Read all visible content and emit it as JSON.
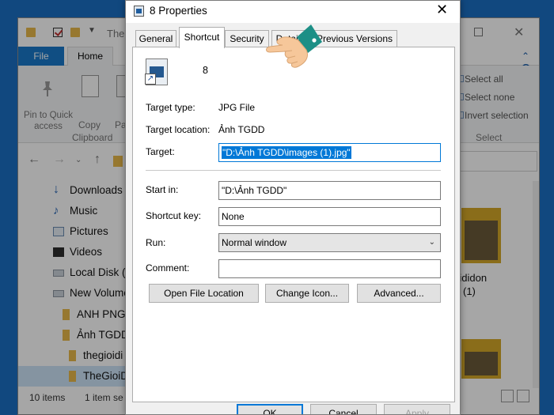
{
  "explorer": {
    "title": "The",
    "tabs": {
      "file": "File",
      "home": "Home"
    },
    "ribbon": {
      "pin_label": "Pin to Quick access",
      "copy_label": "Copy",
      "paste_label": "Pa",
      "clipboard_group": "Clipboard",
      "select_all": "Select all",
      "select_none": "Select none",
      "invert_selection": "Invert selection",
      "select_group": "Select"
    },
    "sidebar": [
      {
        "label": "Downloads",
        "icon": "download-icon"
      },
      {
        "label": "Music",
        "icon": "music-icon"
      },
      {
        "label": "Pictures",
        "icon": "pictures-icon"
      },
      {
        "label": "Videos",
        "icon": "videos-icon"
      },
      {
        "label": "Local Disk (C",
        "icon": "disk-icon"
      },
      {
        "label": "New Volume",
        "icon": "disk-icon"
      },
      {
        "label": "ANH PNG",
        "icon": "folder-icon"
      },
      {
        "label": "Ảnh TGDD",
        "icon": "folder-icon"
      },
      {
        "label": "thegioidi",
        "icon": "folder-icon"
      },
      {
        "label": "TheGioiD",
        "icon": "folder-icon"
      }
    ],
    "files": [
      {
        "name_line1": "gioididon",
        "name_line2": "(1)"
      }
    ],
    "status": {
      "items": "10 items",
      "selected": "1 item se"
    }
  },
  "dialog": {
    "title": "8 Properties",
    "tabs": [
      "General",
      "Shortcut",
      "Security",
      "Details",
      "Previous Versions"
    ],
    "active_tab": "Shortcut",
    "file_name": "8",
    "target_type_label": "Target type:",
    "target_type_value": "JPG File",
    "target_location_label": "Target location:",
    "target_location_value": "Ảnh TGDD",
    "target_label": "Target:",
    "target_value": "\"D:\\Ảnh TGDD\\images (1).jpg\"",
    "start_in_label": "Start in:",
    "start_in_value": "\"D:\\Ảnh TGDD\"",
    "shortcut_key_label": "Shortcut key:",
    "shortcut_key_value": "None",
    "run_label": "Run:",
    "run_value": "Normal window",
    "comment_label": "Comment:",
    "comment_value": "",
    "buttons": {
      "open_location": "Open File Location",
      "change_icon": "Change Icon...",
      "advanced": "Advanced...",
      "ok": "OK",
      "cancel": "Cancel",
      "apply": "Apply"
    }
  },
  "colors": {
    "selection": "#0078d7",
    "accent_hand_cuff": "#1d8f86",
    "hand_skin": "#f6c79a"
  }
}
